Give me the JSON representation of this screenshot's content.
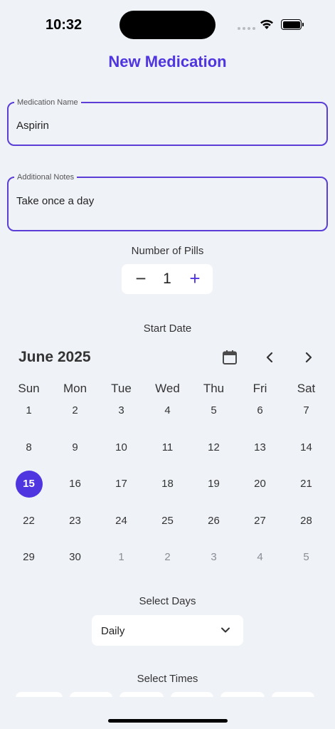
{
  "status_bar": {
    "time": "10:32"
  },
  "header": {
    "title": "New Medication"
  },
  "form": {
    "name": {
      "label": "Medication Name",
      "value": "Aspirin"
    },
    "notes": {
      "label": "Additional Notes",
      "value": "Take once a day"
    },
    "pills": {
      "label": "Number of Pills",
      "value": "1",
      "decrement": "−",
      "increment": "+"
    },
    "start_date": {
      "label": "Start Date",
      "month": "June 2025",
      "weekdays": [
        "Sun",
        "Mon",
        "Tue",
        "Wed",
        "Thu",
        "Fri",
        "Sat"
      ],
      "days": [
        "1",
        "2",
        "3",
        "4",
        "5",
        "6",
        "7",
        "8",
        "9",
        "10",
        "11",
        "12",
        "13",
        "14",
        "15",
        "16",
        "17",
        "18",
        "19",
        "20",
        "21",
        "22",
        "23",
        "24",
        "25",
        "26",
        "27",
        "28",
        "29",
        "30",
        "1",
        "2",
        "3",
        "4",
        "5"
      ],
      "selected": "15"
    },
    "select_days": {
      "label": "Select Days",
      "value": "Daily"
    },
    "select_times": {
      "label": "Select Times"
    }
  },
  "icons": {
    "calendar": "calendar-icon",
    "prev": "chevron-left-icon",
    "next": "chevron-right-icon",
    "dropdown": "chevron-down-icon",
    "wifi": "wifi-icon",
    "battery": "battery-icon",
    "signal": "signal-icon"
  },
  "colors": {
    "accent": "#4f35e0",
    "background": "#eff2f7",
    "field_border": "#5a3ed6"
  }
}
